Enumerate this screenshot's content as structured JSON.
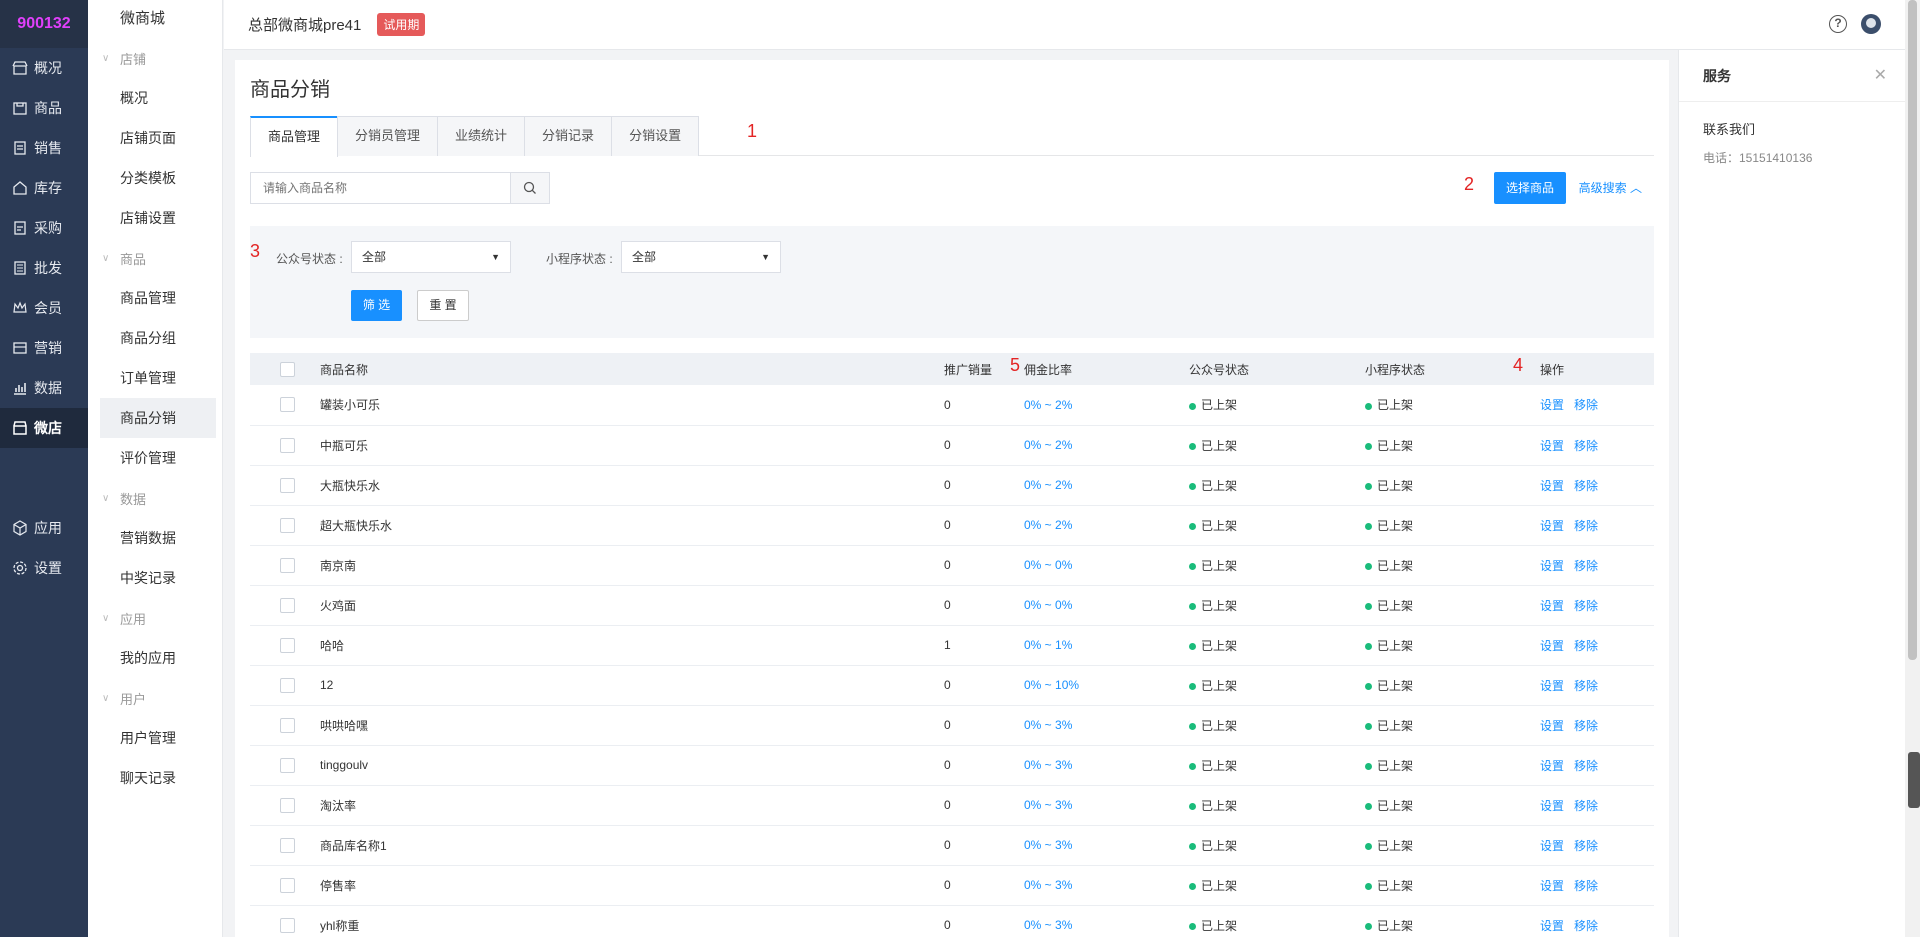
{
  "brand": "900132",
  "primary_nav": [
    {
      "label": "概况",
      "icon": "shop-icon"
    },
    {
      "label": "商品",
      "icon": "goods-icon"
    },
    {
      "label": "销售",
      "icon": "sales-icon"
    },
    {
      "label": "库存",
      "icon": "warehouse-icon"
    },
    {
      "label": "采购",
      "icon": "purchase-icon"
    },
    {
      "label": "批发",
      "icon": "wholesale-icon"
    },
    {
      "label": "会员",
      "icon": "crown-icon"
    },
    {
      "label": "营销",
      "icon": "marketing-icon"
    },
    {
      "label": "数据",
      "icon": "chart-icon"
    },
    {
      "label": "微店",
      "icon": "store-icon",
      "active": true
    },
    {
      "label": "应用",
      "icon": "cube-icon"
    },
    {
      "label": "设置",
      "icon": "gear-icon"
    }
  ],
  "secondary_nav": {
    "title": "微商城",
    "groups": [
      {
        "label": "店铺",
        "items": [
          "概况",
          "店铺页面",
          "分类模板",
          "店铺设置"
        ]
      },
      {
        "label": "商品",
        "items": [
          "商品管理",
          "商品分组",
          "订单管理",
          "商品分销",
          "评价管理"
        ]
      },
      {
        "label": "数据",
        "items": [
          "营销数据",
          "中奖记录"
        ]
      },
      {
        "label": "应用",
        "items": [
          "我的应用"
        ]
      },
      {
        "label": "用户",
        "items": [
          "用户管理",
          "聊天记录"
        ]
      }
    ],
    "active_item": "商品分销"
  },
  "header": {
    "shop_name": "总部微商城pre41",
    "trial_badge": "试用期"
  },
  "page": {
    "title": "商品分销",
    "tabs": [
      "商品管理",
      "分销员管理",
      "业绩统计",
      "分销记录",
      "分销设置"
    ],
    "search_placeholder": "请输入商品名称",
    "select_goods": "选择商品",
    "advanced_search": "高级搜索",
    "filter": {
      "official_label": "公众号状态 :",
      "official_value": "全部",
      "mini_label": "小程序状态 :",
      "mini_value": "全部",
      "filter_btn": "筛 选",
      "reset_btn": "重 置"
    },
    "annotations": {
      "a1": "1",
      "a2": "2",
      "a3": "3",
      "a4": "4",
      "a5": "5"
    },
    "columns": [
      "商品名称",
      "推广销量",
      "佣金比率",
      "公众号状态",
      "小程序状态",
      "操作"
    ],
    "rows": [
      {
        "name": "罐装小可乐",
        "sales": "0",
        "rate": "0% ~ 2%"
      },
      {
        "name": "中瓶可乐",
        "sales": "0",
        "rate": "0% ~ 2%"
      },
      {
        "name": "大瓶快乐水",
        "sales": "0",
        "rate": "0% ~ 2%"
      },
      {
        "name": "超大瓶快乐水",
        "sales": "0",
        "rate": "0% ~ 2%"
      },
      {
        "name": "南京南",
        "sales": "0",
        "rate": "0% ~ 0%"
      },
      {
        "name": "火鸡面",
        "sales": "0",
        "rate": "0% ~ 0%"
      },
      {
        "name": "哈哈",
        "sales": "1",
        "rate": "0% ~ 1%"
      },
      {
        "name": "12",
        "sales": "0",
        "rate": "0% ~ 10%"
      },
      {
        "name": "哄哄哈嘿",
        "sales": "0",
        "rate": "0% ~ 3%"
      },
      {
        "name": "tinggoulv",
        "sales": "0",
        "rate": "0% ~ 3%"
      },
      {
        "name": "淘汰率",
        "sales": "0",
        "rate": "0% ~ 3%"
      },
      {
        "name": "商品库名称1",
        "sales": "0",
        "rate": "0% ~ 3%"
      },
      {
        "name": "停售率",
        "sales": "0",
        "rate": "0% ~ 3%"
      },
      {
        "name": "yhl称重",
        "sales": "0",
        "rate": "0% ~ 3%"
      }
    ],
    "status_text": "已上架",
    "op_set": "设置",
    "op_remove": "移除"
  },
  "service": {
    "title": "服务",
    "contact": "联系我们",
    "phone": "电话：15151410136"
  },
  "colors": {
    "primary": "#1890ff",
    "sidebar": "#2b3a55",
    "status_dot": "#1abc7b",
    "annotation": "#e32424",
    "trial": "#e55a5a"
  }
}
